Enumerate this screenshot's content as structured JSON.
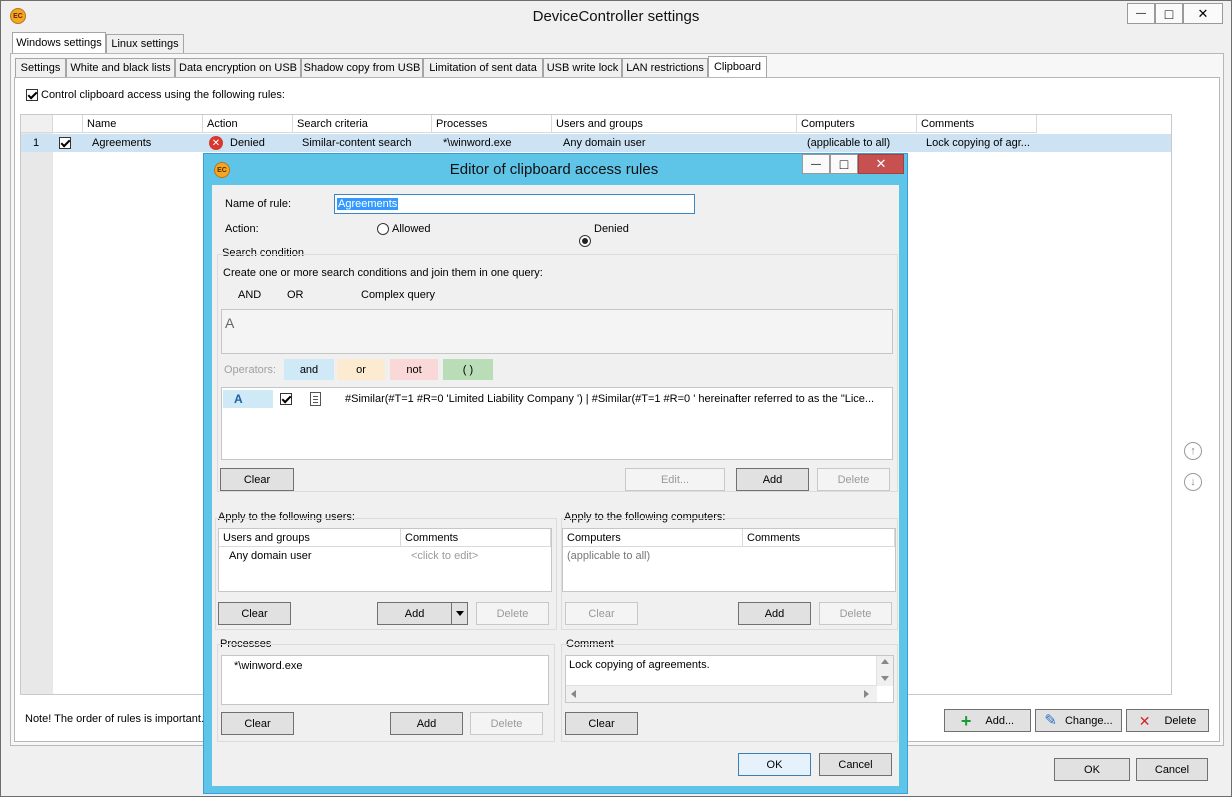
{
  "window": {
    "title": "DeviceController settings",
    "minimize_symbol": "—",
    "maximize_symbol": "□",
    "close_symbol": "✕"
  },
  "os_tabs": [
    {
      "label": "Windows settings",
      "active": true
    },
    {
      "label": "Linux settings",
      "active": false
    }
  ],
  "feature_tabs": [
    {
      "label": "Settings"
    },
    {
      "label": "White and black lists"
    },
    {
      "label": "Data encryption on USB"
    },
    {
      "label": "Shadow copy from USB"
    },
    {
      "label": "Limitation of sent data"
    },
    {
      "label": "USB write lock"
    },
    {
      "label": "LAN restrictions"
    },
    {
      "label": "Clipboard",
      "active": true
    }
  ],
  "clipboard": {
    "control_label": "Control clipboard access using the following rules:",
    "control_checked": true,
    "columns": [
      "Name",
      "Action",
      "Search criteria",
      "Processes",
      "Users and groups",
      "Computers",
      "Comments"
    ],
    "rows": [
      {
        "index": "1",
        "checked": true,
        "name": "Agreements",
        "action": "Denied",
        "search_criteria": "Similar-content search",
        "processes": "*\\winword.exe",
        "users": "Any domain user",
        "computers": "(applicable to all)",
        "comments": "Lock copying of agr..."
      }
    ],
    "note": "Note! The order of rules is important.",
    "add_label": "Add...",
    "change_label": "Change...",
    "delete_label": "Delete"
  },
  "main_buttons": {
    "ok": "OK",
    "cancel": "Cancel"
  },
  "dialog": {
    "title": "Editor of clipboard access rules",
    "name_label": "Name of rule:",
    "name_value": "Agreements",
    "action_label": "Action:",
    "allowed_label": "Allowed",
    "denied_label": "Denied",
    "search_section": "Search condition",
    "search_hint": "Create one or more search conditions and join them in one query:",
    "and_label": "AND",
    "or_label": "OR",
    "complex_label": "Complex query",
    "query_text": "A",
    "operators_label": "Operators:",
    "operators": {
      "and": "and",
      "or": "or",
      "not": "not",
      "paren": "( )"
    },
    "condition": {
      "letter": "A",
      "checked": true,
      "text": "#Similar(#T=1 #R=0 'Limited Liability Company ') | #Similar(#T=1 #R=0 ' hereinafter referred to as the \"Lice..."
    },
    "clear_label": "Clear",
    "edit_label": "Edit...",
    "add_label": "Add",
    "delete_label": "Delete",
    "users_section": "Apply to the following users:",
    "users_columns": [
      "Users and groups",
      "Comments"
    ],
    "users_row": {
      "name": "Any domain user",
      "comment": "<click to edit>"
    },
    "computers_section": "Apply to the following computers:",
    "computers_columns": [
      "Computers",
      "Comments"
    ],
    "computers_row": {
      "name": "(applicable to all)"
    },
    "processes_section": "Processes",
    "process_item": "*\\winword.exe",
    "comment_section": "Comment",
    "comment_text": "Lock copying of agreements.",
    "ok_label": "OK",
    "cancel_label": "Cancel"
  },
  "colors": {
    "dialog_frame": "#5ec5e9",
    "selected_row": "#cde3f3",
    "op_and": "#cfe9f7",
    "op_or": "#fcebd0",
    "op_not": "#fbd8d8",
    "op_paren": "#b9ddb7"
  }
}
